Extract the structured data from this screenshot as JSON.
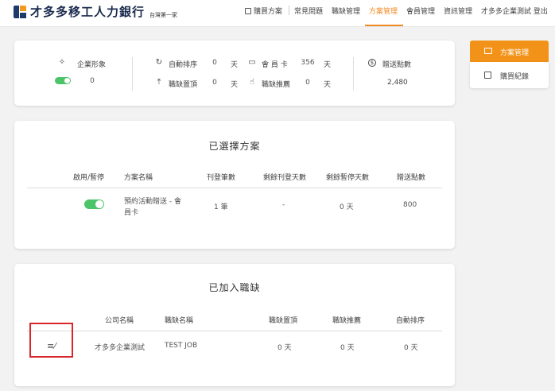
{
  "header": {
    "logo_text": "才多多移工人力銀行",
    "logo_sub": "台灣第一家",
    "nav": {
      "buy_plan": "購買方案",
      "faq": "常見問題",
      "jobs": "職缺管理",
      "plans": "方案管理",
      "members": "會員管理",
      "profile": "資訊管理",
      "company_user": "才多多企業測試 登出"
    }
  },
  "summary": {
    "brand_label": "企業形象",
    "brand_value": "0",
    "auto_sort_label": "自動排序",
    "auto_sort_value": "0",
    "auto_sort_unit": "天",
    "top_label": "職缺置頂",
    "top_value": "0",
    "top_unit": "天",
    "member_card_label": "會 員 卡",
    "member_card_value": "356",
    "member_card_unit": "天",
    "recommend_label": "職缺推薦",
    "recommend_value": "0",
    "recommend_unit": "天",
    "points_label": "贈送點數",
    "points_value": "2,480"
  },
  "selected_plans": {
    "title": "已選擇方案",
    "headers": [
      "啟用/暫停",
      "方案名稱",
      "刊登筆數",
      "剩餘刊登天數",
      "剩餘暫停天數",
      "贈送點數"
    ],
    "row": {
      "name_line1": "預約活動贈送 - 會",
      "name_line2": "員卡",
      "count": "1 筆",
      "remaining_days": "-",
      "paused_days": "0 天",
      "points": "800"
    }
  },
  "joined_jobs": {
    "title": "已加入職缺",
    "headers": [
      "公司名稱",
      "職缺名稱",
      "職缺置頂",
      "職缺推薦",
      "自動排序"
    ],
    "row": {
      "company": "才多多企業測試",
      "job": "TEST JOB",
      "top": "0 天",
      "recommend": "0 天",
      "auto_sort": "0 天"
    }
  },
  "sidebar": {
    "plan_manage": "方案管理",
    "purchase_record": "購買紀錄"
  },
  "colors": {
    "accent": "#f39218",
    "toggle_on": "#4cc46a",
    "highlight_box": "#d9262b"
  }
}
